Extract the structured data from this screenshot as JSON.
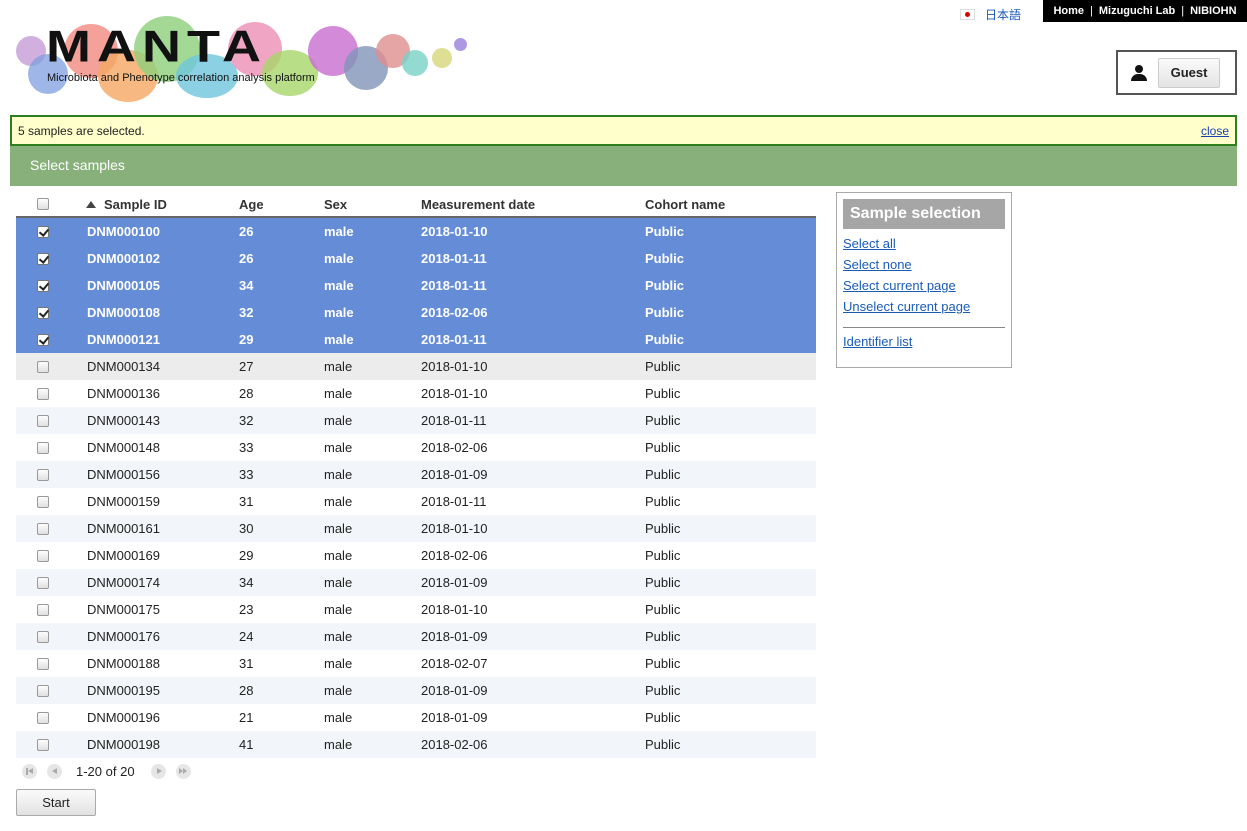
{
  "logo": {
    "title": "MANTA",
    "subtitle": "Microbiota and Phenotype correlation analysis platform"
  },
  "language": {
    "label": "日本語"
  },
  "topnav": {
    "items": [
      "Home",
      "Mizuguchi Lab",
      "NIBIOHN"
    ]
  },
  "user": {
    "label": "Guest"
  },
  "notice": {
    "text": "5 samples are selected.",
    "close": "close"
  },
  "section": {
    "title": "Select samples"
  },
  "table": {
    "headers": {
      "sample_id": "Sample ID",
      "age": "Age",
      "sex": "Sex",
      "date": "Measurement date",
      "cohort": "Cohort name"
    },
    "sort": "sample_id ascending",
    "rows": [
      {
        "id": "DNM000100",
        "age": "26",
        "sex": "male",
        "date": "2018-01-10",
        "cohort": "Public",
        "selected": true
      },
      {
        "id": "DNM000102",
        "age": "26",
        "sex": "male",
        "date": "2018-01-11",
        "cohort": "Public",
        "selected": true
      },
      {
        "id": "DNM000105",
        "age": "34",
        "sex": "male",
        "date": "2018-01-11",
        "cohort": "Public",
        "selected": true
      },
      {
        "id": "DNM000108",
        "age": "32",
        "sex": "male",
        "date": "2018-02-06",
        "cohort": "Public",
        "selected": true
      },
      {
        "id": "DNM000121",
        "age": "29",
        "sex": "male",
        "date": "2018-01-11",
        "cohort": "Public",
        "selected": true
      },
      {
        "id": "DNM000134",
        "age": "27",
        "sex": "male",
        "date": "2018-01-10",
        "cohort": "Public",
        "selected": false,
        "hover": true
      },
      {
        "id": "DNM000136",
        "age": "28",
        "sex": "male",
        "date": "2018-01-10",
        "cohort": "Public",
        "selected": false
      },
      {
        "id": "DNM000143",
        "age": "32",
        "sex": "male",
        "date": "2018-01-11",
        "cohort": "Public",
        "selected": false
      },
      {
        "id": "DNM000148",
        "age": "33",
        "sex": "male",
        "date": "2018-02-06",
        "cohort": "Public",
        "selected": false
      },
      {
        "id": "DNM000156",
        "age": "33",
        "sex": "male",
        "date": "2018-01-09",
        "cohort": "Public",
        "selected": false
      },
      {
        "id": "DNM000159",
        "age": "31",
        "sex": "male",
        "date": "2018-01-11",
        "cohort": "Public",
        "selected": false
      },
      {
        "id": "DNM000161",
        "age": "30",
        "sex": "male",
        "date": "2018-01-10",
        "cohort": "Public",
        "selected": false
      },
      {
        "id": "DNM000169",
        "age": "29",
        "sex": "male",
        "date": "2018-02-06",
        "cohort": "Public",
        "selected": false
      },
      {
        "id": "DNM000174",
        "age": "34",
        "sex": "male",
        "date": "2018-01-09",
        "cohort": "Public",
        "selected": false
      },
      {
        "id": "DNM000175",
        "age": "23",
        "sex": "male",
        "date": "2018-01-10",
        "cohort": "Public",
        "selected": false
      },
      {
        "id": "DNM000176",
        "age": "24",
        "sex": "male",
        "date": "2018-01-09",
        "cohort": "Public",
        "selected": false
      },
      {
        "id": "DNM000188",
        "age": "31",
        "sex": "male",
        "date": "2018-02-07",
        "cohort": "Public",
        "selected": false
      },
      {
        "id": "DNM000195",
        "age": "28",
        "sex": "male",
        "date": "2018-01-09",
        "cohort": "Public",
        "selected": false
      },
      {
        "id": "DNM000196",
        "age": "21",
        "sex": "male",
        "date": "2018-01-09",
        "cohort": "Public",
        "selected": false
      },
      {
        "id": "DNM000198",
        "age": "41",
        "sex": "male",
        "date": "2018-02-06",
        "cohort": "Public",
        "selected": false
      }
    ]
  },
  "pager": {
    "info": "1-20 of 20"
  },
  "start_button": {
    "label": "Start"
  },
  "side_panel": {
    "title": "Sample selection",
    "links": [
      "Select all",
      "Select none",
      "Select current page",
      "Unselect current page"
    ],
    "identifier_link": "Identifier list"
  },
  "colors": {
    "selected_row": "#658cd6",
    "section_bar": "#88b07a",
    "notice_bg": "#ffffcc",
    "notice_border": "#2e7d1e",
    "link": "#1a5bb5"
  },
  "icons": [
    "japan-flag-icon",
    "person-icon",
    "sort-ascending-icon",
    "first-page-icon",
    "prev-page-icon",
    "next-page-icon",
    "last-page-icon"
  ]
}
